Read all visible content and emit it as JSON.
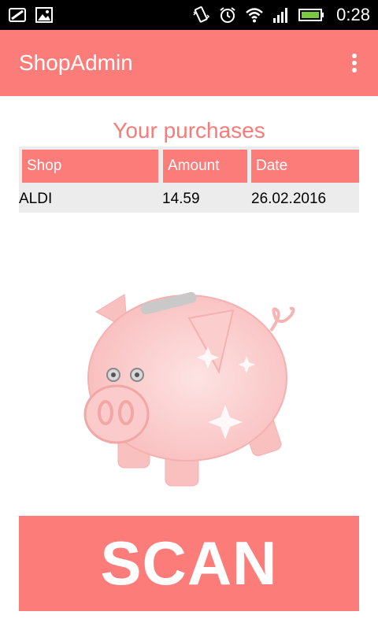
{
  "status_bar": {
    "time": "0:28",
    "icons": [
      "screenshot-icon",
      "image-icon",
      "vibrate-icon",
      "alarm-icon",
      "wifi-icon",
      "signal-icon",
      "battery-icon"
    ]
  },
  "action_bar": {
    "title": "ShopAdmin",
    "menu_icon": "overflow-menu-icon"
  },
  "purchases": {
    "heading": "Your purchases",
    "columns": [
      "Shop",
      "Amount",
      "Date"
    ],
    "rows": [
      {
        "shop": "ALDI",
        "amount": "14.59",
        "date": "26.02.2016"
      }
    ]
  },
  "illustration": "piggy-bank",
  "scan_button": {
    "label": "SCAN"
  },
  "colors": {
    "accent": "#fc7c79",
    "heading": "#f77c78",
    "table_bg": "#ececec",
    "piggy": "#fbc6c6"
  }
}
